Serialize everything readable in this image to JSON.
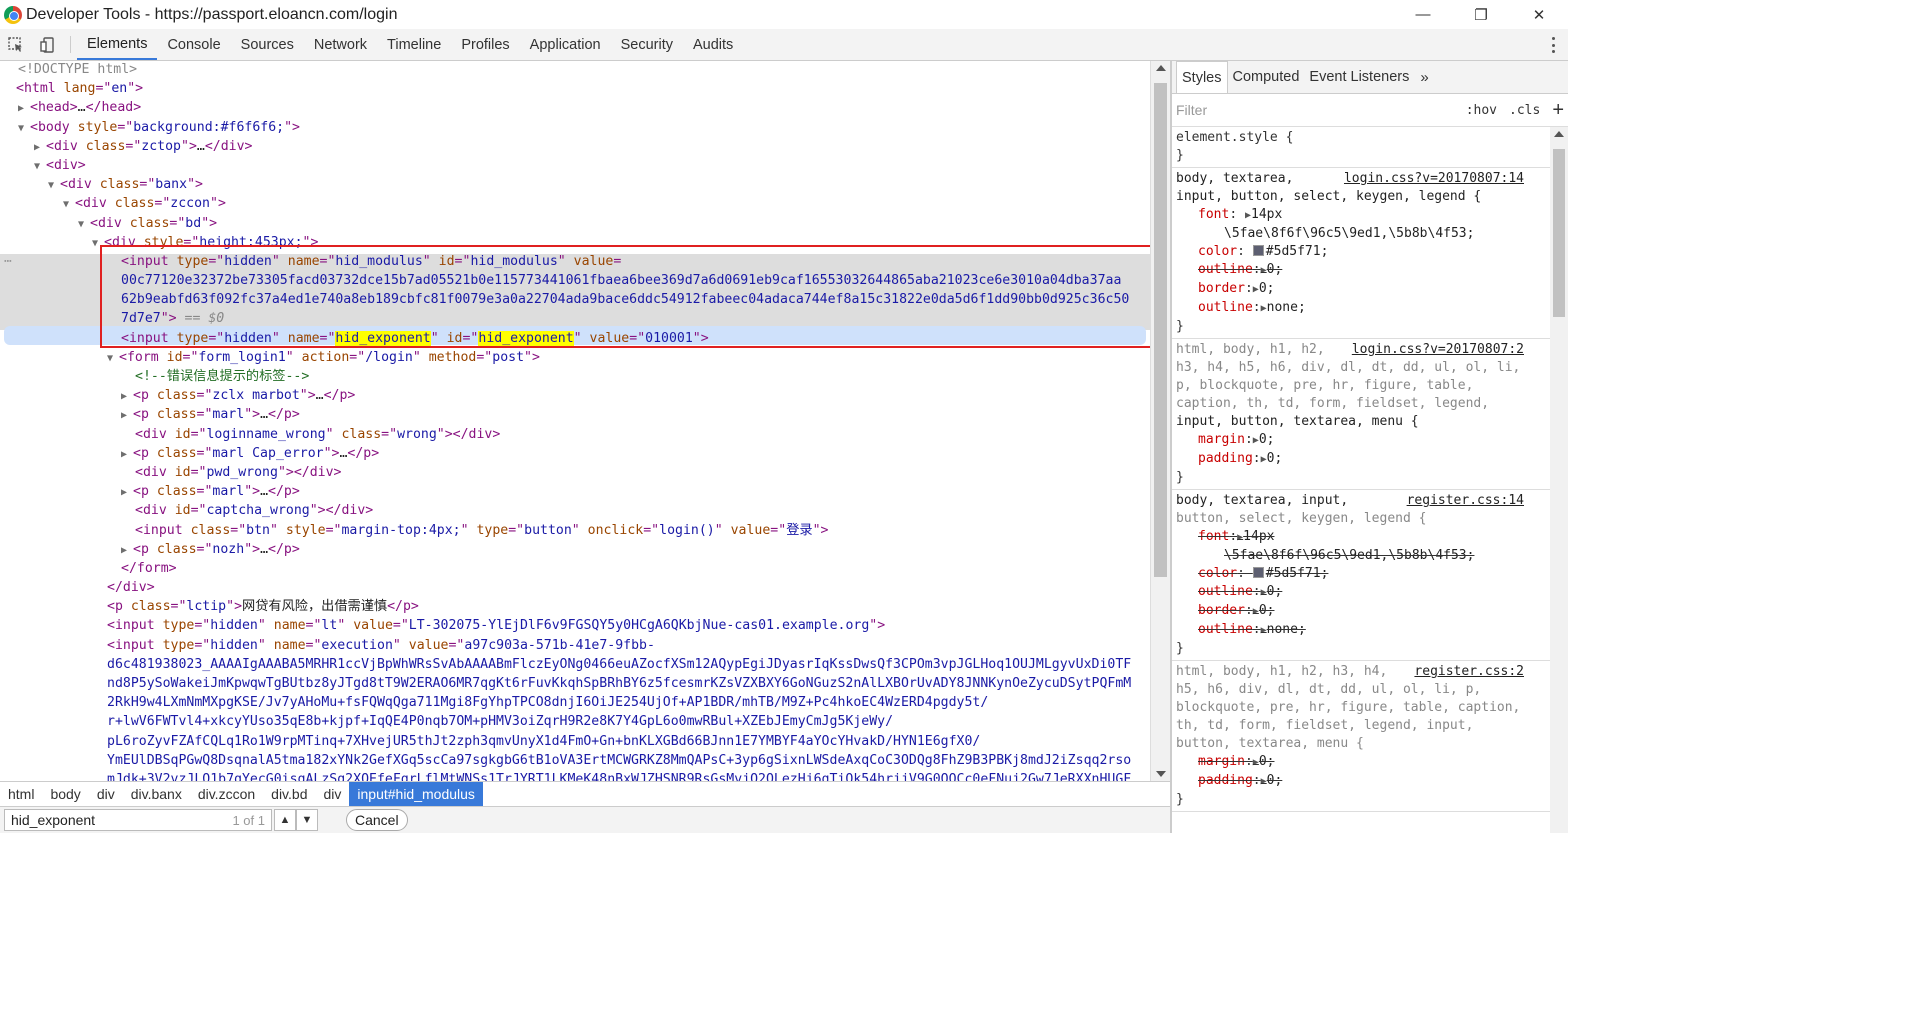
{
  "window": {
    "title": "Developer Tools - https://passport.eloancn.com/login",
    "controls": [
      "—",
      "❐",
      "✕"
    ]
  },
  "toolbar": {
    "tabs": [
      "Elements",
      "Console",
      "Sources",
      "Network",
      "Timeline",
      "Profiles",
      "Application",
      "Security",
      "Audits"
    ],
    "active_tab": "Elements"
  },
  "dom": {
    "l01": "<!DOCTYPE html>",
    "html_open": "html",
    "html_lang": "en",
    "head": "…",
    "body_style": "background:#f6f6f6;",
    "div_zctop": "zctop",
    "div_banx": "banx",
    "div_zccon": "zccon",
    "div_bd": "bd",
    "div_height": "height:453px;",
    "input1_type": "hidden",
    "input1_name": "hid_modulus",
    "input1_id": "hid_modulus",
    "input1_value_1": "00c77120e32372be73305facd03732dce15b7ad05521b0e115773441061fbaea6bee369d7a6d0691eb9caf16553032644865aba21023ce6e3010a04dba37aa",
    "input1_value_2": "62b9eabfd63f092fc37a4ed1e740a8eb189cbfc81f0079e3a0a22704ada9bace6ddc54912fabeec04adaca744ef8a15c31822e0da5d6f1dd90bb0d925c36c50",
    "input1_value_3": "7d7e7",
    "eq0": "== $0",
    "input2_type": "hidden",
    "input2_name": "hid_exponent",
    "input2_id": "hid_exponent",
    "input2_value": "010001",
    "form_id": "form_login1",
    "form_action": "/login",
    "form_method": "post",
    "comment": "<!--错误信息提示的标签-->",
    "p1_class": "zclx marbot",
    "p2_class": "marl",
    "div_loginname_id": "loginname_wrong",
    "div_loginname_class": "wrong",
    "p3_class": "marl Cap_error",
    "div_pwd_id": "pwd_wrong",
    "p4_class": "marl",
    "div_captcha_id": "captcha_wrong",
    "btn_class": "btn",
    "btn_style": "margin-top:4px;",
    "btn_type": "button",
    "btn_onclick": "login()",
    "btn_value": "登录",
    "p5_class": "nozh",
    "lctip_class": "lctip",
    "lctip_text": "网贷有风险，出借需谨慎",
    "lt_type": "hidden",
    "lt_name": "lt",
    "lt_value": "LT-302075-YlEjDlF6v9FGSQY5y0HCgA6QKbjNue-cas01.example.org",
    "exec_type": "hidden",
    "exec_name": "execution",
    "exec_value_1": "a97c903a-571b-41e7-9fbb-",
    "exec_value_2": "d6c481938023_AAAAIgAAABA5MRHR1ccVjBpWhWRsSvAbAAAABmFlczEyONg0466euAZocfXSm12AQypEgiJDyasrIqKssDwsQf3CPOm3vpJGLHoq1OUJMLgyvUxDi0TF",
    "exec_value_3": "nd8P5ySoWakeiJmKpwqwTgBUtbz8yJTgd8tT9W2ERAO6MR7qgKt6rFuvKkqhSpBRhBY6z5fcesmrKZsVZXBXY6GoNGuzS2nAlLXBOrUvADY8JNNKynOeZycuDSytPQFmM",
    "exec_value_4": "2RkH9w4LXmNmMXpgKSE/Jv7yAHoMu+fsFQWqQga711Mgi8FgYhpTPCO8dnjI6OiJE254UjOf+AP1BDR/mhTB/M9Z+Pc4hkoEC4WzERD4pgdy5t/",
    "exec_value_5": "r+lwV6FWTvl4+xkcyYUso35qE8b+kjpf+IqQE4P0nqb7OM+pHMV3oiZqrH9R2e8K7Y4GpL6o0mwRBul+XZEbJEmyCmJg5KjeWy/",
    "exec_value_6": "pL6roZyvFZAfCQLq1Ro1W9rpMTinq+7XHvejUR5thJt2zph3qmvUnyX1d4FmO+Gn+bnKLXGBd66BJnn1E7YMBYF4aYOcYHvakD/HYN1E6gfX0/",
    "exec_value_7": "YmEUlDBSqPGwQ8DsqnalA5tma182xYNk2GefXGq5scCa97sgkgbG6tB1oVA3ErtMCWGRKZ8MmQAPsC+3yp6gSixnLWSdeAxqCoC3ODQg8FhZ9B3PBKj8mdJ2iZsqq2rso",
    "exec_value_8": "mJdk+3V2vzJLO1b7qYecG0isqALzSg2XQEfeFqrLflMtWNSs1TrJYRT1LKMeK48nBxWJZHSNR9RsGsMvjQ2OLezHj6qTiQk54hrjjV9G0QQCc0eFNuj2Gw7JeRXXnHUGF"
  },
  "breadcrumbs": [
    "html",
    "body",
    "div",
    "div.banx",
    "div.zccon",
    "div.bd",
    "div",
    "input#hid_modulus"
  ],
  "search": {
    "query": "hid_exponent",
    "count": "1 of 1",
    "cancel_label": "Cancel"
  },
  "sidebar": {
    "tabs": [
      "Styles",
      "Computed",
      "Event Listeners"
    ],
    "more": "»",
    "filter_placeholder": "Filter",
    "hov": ":hov",
    "cls": ".cls",
    "plus": "+",
    "r0_sel": "element.style {",
    "close": "}",
    "r1_sel1": "body, textarea,",
    "r1_src": "login.css?v=20170807:14",
    "r1_sel2": "input, button, select, keygen, legend {",
    "r1_font_n": "font",
    "r1_font_v1": "14px",
    "r1_font_v2": "\\5fae\\8f6f\\96c5\\9ed1,\\5b8b\\4f53;",
    "r1_color_n": "color",
    "r1_color_v": "#5d5f71;",
    "r1_outline_n": "outline",
    "r1_outline_v": "0;",
    "r1_border_n": "border",
    "r1_border_v": "0;",
    "r1_outline2_n": "outline",
    "r1_outline2_v": "none;",
    "r2_sel1": "html, body, h1, h2,",
    "r2_src": "login.css?v=20170807:2",
    "r2_sel2": "h3, h4, h5, h6, div, dl, dt, dd, ul, ol, li,",
    "r2_sel3": "p, blockquote, pre, hr, figure, table,",
    "r2_sel4": "caption, th, td, form, fieldset, legend,",
    "r2_sel5": "input, button, textarea, menu {",
    "r2_margin_n": "margin",
    "r2_margin_v": "0;",
    "r2_padding_n": "padding",
    "r2_padding_v": "0;",
    "r3_sel1": "body, textarea, input,",
    "r3_src": "register.css:14",
    "r3_sel2": "button, select, keygen, legend {",
    "r4_sel1": "html, body, h1, h2, h3, h4,",
    "r4_src": "register.css:2",
    "r4_sel2": "h5, h6, div, dl, dt, dd, ul, ol, li, p,",
    "r4_sel3": "blockquote, pre, hr, figure, table, caption,",
    "r4_sel4": "th, td, form, fieldset, legend, input,",
    "r4_sel5": "button, textarea, menu {"
  },
  "colors": {
    "accent": "#3879d9",
    "highlight_box": "#e02020",
    "search_match": "#ffff00"
  }
}
